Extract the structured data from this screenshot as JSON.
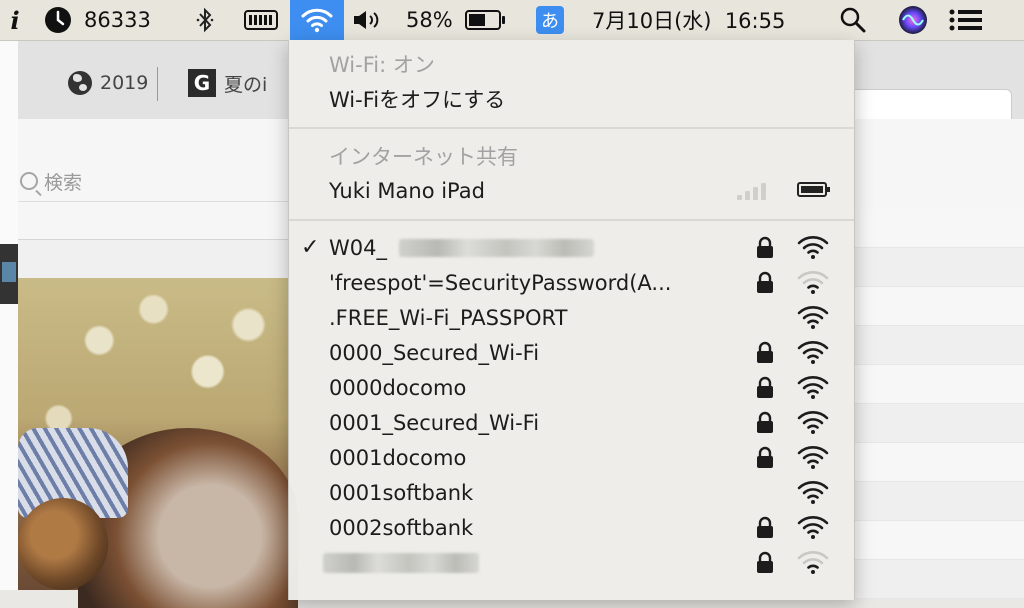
{
  "menubar": {
    "counter": "86333",
    "battery_percent": "58%",
    "ime_label": "あ",
    "datetime": "7月10日(水)  16:55",
    "icons": [
      "info-icon",
      "clock-icon",
      "bluetooth-icon",
      "battery-strip-icon",
      "wifi-icon",
      "volume-icon",
      "battery-icon",
      "search-icon",
      "siri-icon",
      "notification-list-icon"
    ]
  },
  "browser": {
    "tabs": [
      {
        "label": "2019",
        "icon": "globe-icon"
      },
      {
        "label": "夏のi",
        "icon": "g-icon",
        "icon_text": "G"
      }
    ],
    "search_placeholder": "検索"
  },
  "wifi_menu": {
    "status": "Wi-Fi: オン",
    "toggle": "Wi-Fiをオフにする",
    "hotspot_header": "インターネット共有",
    "hotspot_name": "Yuki Mano iPad",
    "networks": [
      {
        "name": "W04_",
        "connected": true,
        "locked": true,
        "signal": "strong"
      },
      {
        "name": "'freespot'=SecurityPassword(A...",
        "connected": false,
        "locked": true,
        "signal": "weak"
      },
      {
        "name": ".FREE_Wi-Fi_PASSPORT",
        "connected": false,
        "locked": false,
        "signal": "strong"
      },
      {
        "name": "0000_Secured_Wi-Fi",
        "connected": false,
        "locked": true,
        "signal": "strong"
      },
      {
        "name": "0000docomo",
        "connected": false,
        "locked": true,
        "signal": "strong"
      },
      {
        "name": "0001_Secured_Wi-Fi",
        "connected": false,
        "locked": true,
        "signal": "strong"
      },
      {
        "name": "0001docomo",
        "connected": false,
        "locked": true,
        "signal": "strong"
      },
      {
        "name": "0001softbank",
        "connected": false,
        "locked": false,
        "signal": "strong"
      },
      {
        "name": "0002softbank",
        "connected": false,
        "locked": true,
        "signal": "strong"
      },
      {
        "name": "",
        "connected": false,
        "locked": true,
        "signal": "weak"
      }
    ],
    "checkmark": "✓"
  },
  "colors": {
    "accent": "#3d8ef0",
    "menubar_bg": "#e8e6dc",
    "menu_bg": "#eeede9"
  }
}
